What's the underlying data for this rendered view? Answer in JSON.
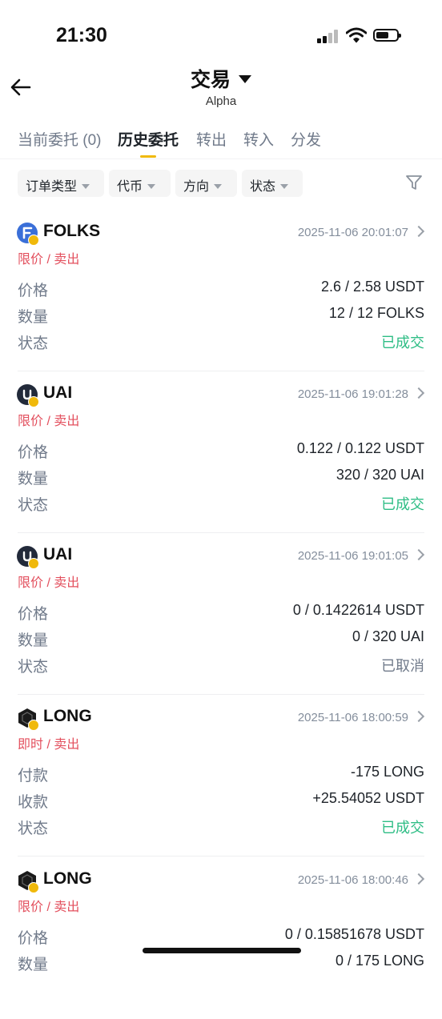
{
  "status": {
    "time": "21:30"
  },
  "header": {
    "title": "交易",
    "subtitle": "Alpha"
  },
  "tabs": [
    {
      "label": "当前委托 (0)"
    },
    {
      "label": "历史委托"
    },
    {
      "label": "转出"
    },
    {
      "label": "转入"
    },
    {
      "label": "分发"
    }
  ],
  "filters": [
    {
      "label": "订单类型"
    },
    {
      "label": "代币"
    },
    {
      "label": "方向"
    },
    {
      "label": "状态"
    }
  ],
  "colors": {
    "accent": "#f0b90b",
    "sell": "#e3505e",
    "filled": "#2ebd85",
    "muted": "#707a8a"
  },
  "orders": [
    {
      "icon": "folks-token-icon",
      "symbol": "FOLKS",
      "time": "2025-11-06 20:01:07",
      "side": "限价 / 卖出",
      "rows": [
        {
          "label": "价格",
          "value": "2.6 / 2.58 USDT"
        },
        {
          "label": "数量",
          "value": "12 / 12 FOLKS"
        },
        {
          "label": "状态",
          "value": "已成交"
        }
      ]
    },
    {
      "icon": "uai-token-icon",
      "symbol": "UAI",
      "time": "2025-11-06 19:01:28",
      "side": "限价 / 卖出",
      "rows": [
        {
          "label": "价格",
          "value": "0.122 / 0.122 USDT"
        },
        {
          "label": "数量",
          "value": "320 / 320 UAI"
        },
        {
          "label": "状态",
          "value": "已成交"
        }
      ]
    },
    {
      "icon": "uai-token-icon",
      "symbol": "UAI",
      "time": "2025-11-06 19:01:05",
      "side": "限价 / 卖出",
      "rows": [
        {
          "label": "价格",
          "value": "0 / 0.1422614 USDT"
        },
        {
          "label": "数量",
          "value": "0 / 320 UAI"
        },
        {
          "label": "状态",
          "value": "已取消"
        }
      ]
    },
    {
      "icon": "long-token-icon",
      "symbol": "LONG",
      "time": "2025-11-06 18:00:59",
      "side": "即时 / 卖出",
      "rows": [
        {
          "label": "付款",
          "value": "-175 LONG"
        },
        {
          "label": "收款",
          "value": "+25.54052 USDT"
        },
        {
          "label": "状态",
          "value": "已成交"
        }
      ]
    },
    {
      "icon": "long-token-icon",
      "symbol": "LONG",
      "time": "2025-11-06 18:00:46",
      "side": "限价 / 卖出",
      "rows": [
        {
          "label": "价格",
          "value": "0 / 0.15851678 USDT"
        },
        {
          "label": "数量",
          "value": "0 / 175 LONG"
        }
      ]
    }
  ]
}
